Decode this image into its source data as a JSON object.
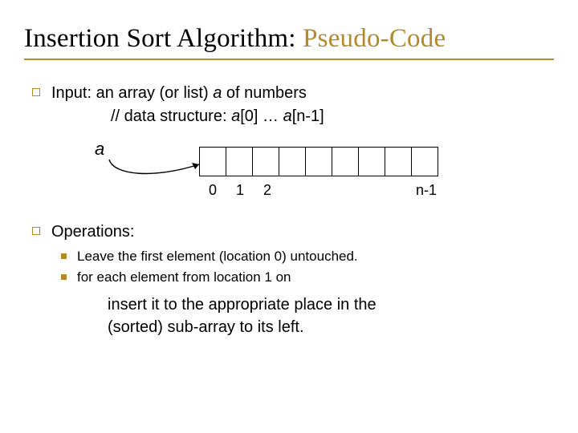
{
  "title_plain": "Insertion Sort Algorithm: ",
  "title_hi": "Pseudo-Code",
  "input_line": "Input: an array (or list) ",
  "input_var": "a",
  "input_line_tail": " of numbers",
  "ds_prefix": "// data structure: ",
  "ds_a0": "a",
  "ds_a0_tail": "[0] … ",
  "ds_an": "a",
  "ds_an_tail": "[n-1]",
  "arr_label": "a",
  "idx": {
    "i0": "0",
    "i1": "1",
    "i2": "2",
    "in": "n-1"
  },
  "ops_heading": "Operations:",
  "sub1": "Leave the first element (location 0) untouched.",
  "sub2": "for each element from location 1 on",
  "conclusion_l1": "insert it to the appropriate place in the",
  "conclusion_l2": "(sorted) sub-array to its left."
}
